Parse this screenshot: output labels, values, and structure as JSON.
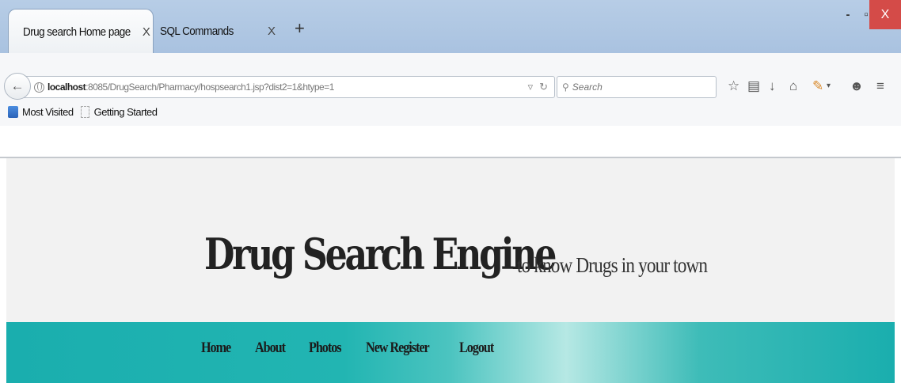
{
  "browser": {
    "tabs": [
      {
        "label": "Drug search Home page",
        "close": "X",
        "active": true
      },
      {
        "label": "SQL Commands",
        "close": "X",
        "active": false
      }
    ],
    "new_tab": "+",
    "window": {
      "minimize": "-",
      "maximize": "▫",
      "close": "X"
    },
    "url": {
      "host": "localhost",
      "path": ":8085/DrugSearch/Pharmacy/hospsearch1.jsp?dist2=1&htype=1"
    },
    "search_placeholder": "Search",
    "bookmarks": [
      "Most Visited",
      "Getting Started"
    ],
    "close_color": "#d44b48"
  },
  "site": {
    "title": "Drug Search Engine",
    "tagline": "to know Drugs in your town",
    "menu": [
      "Home",
      "About",
      "Photos",
      "New Register",
      "Logout"
    ],
    "menu_band_color": "#1aaeae"
  }
}
